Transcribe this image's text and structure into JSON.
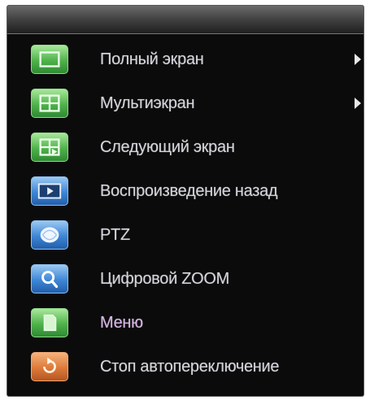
{
  "menu": {
    "items": [
      {
        "label": "Полный экран",
        "icon": "fullscreen-icon",
        "has_submenu": true
      },
      {
        "label": "Мультиэкран",
        "icon": "multiscreen-icon",
        "has_submenu": true
      },
      {
        "label": "Следующий экран",
        "icon": "next-screen-icon",
        "has_submenu": false
      },
      {
        "label": "Воспроизведение назад",
        "icon": "playback-icon",
        "has_submenu": false
      },
      {
        "label": "PTZ",
        "icon": "ptz-icon",
        "has_submenu": false
      },
      {
        "label": "Цифровой ZOOM",
        "icon": "zoom-icon",
        "has_submenu": false
      },
      {
        "label": "Меню",
        "icon": "menu-icon",
        "has_submenu": false
      },
      {
        "label": "Стоп автопереключение",
        "icon": "stop-autoswitch-icon",
        "has_submenu": false
      }
    ],
    "colors": {
      "background": "#0b0b0b",
      "text": "#d4d4dc",
      "icon_green": "#4fb24a",
      "icon_blue": "#3d86d6",
      "icon_orange": "#dd7a3a"
    }
  }
}
